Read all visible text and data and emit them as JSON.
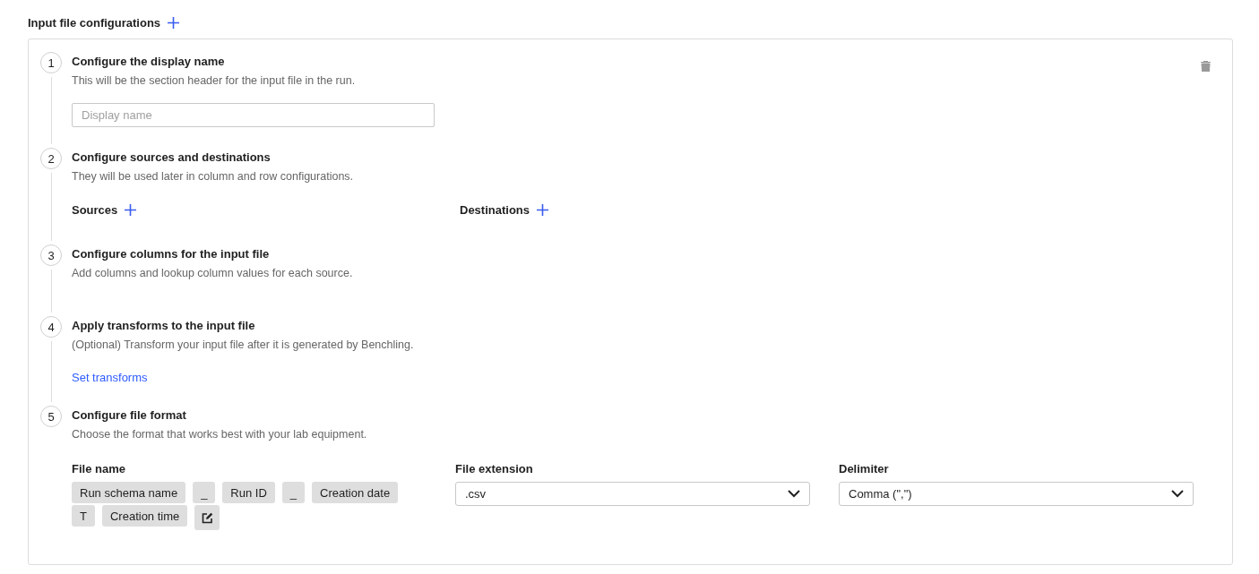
{
  "header": {
    "title": "Input file configurations"
  },
  "steps": [
    {
      "number": "1",
      "title": "Configure the display name",
      "description": "This will be the section header for the input file in the run.",
      "kind": "field",
      "placeholder": "Display name"
    },
    {
      "number": "2",
      "title": "Configure sources and destinations",
      "description": "They will be used later in column and row configurations.",
      "kind": "lists",
      "lists": [
        "Sources",
        "Destinations"
      ]
    },
    {
      "number": "3",
      "title": "Configure columns for the input file",
      "description": "Add columns and lookup column values for each source.",
      "kind": "empty"
    },
    {
      "number": "4",
      "title": "Apply transforms to the input file",
      "description": "(Optional) Transform your input file after it is generated by Benchling.",
      "kind": "link",
      "link": "Set transforms"
    },
    {
      "number": "5",
      "title": "Configure file format",
      "description": "Choose the format that works best with your lab equipment.",
      "kind": "format",
      "file_name": {
        "label": "File name",
        "tokens": [
          "Run schema name",
          "_",
          "Run ID",
          "_",
          "Creation date",
          "T",
          "Creation time"
        ]
      },
      "selects": [
        {
          "label": "File extension",
          "value": ".csv"
        },
        {
          "label": "Delimiter",
          "value": "Comma (\",\")"
        }
      ]
    }
  ]
}
